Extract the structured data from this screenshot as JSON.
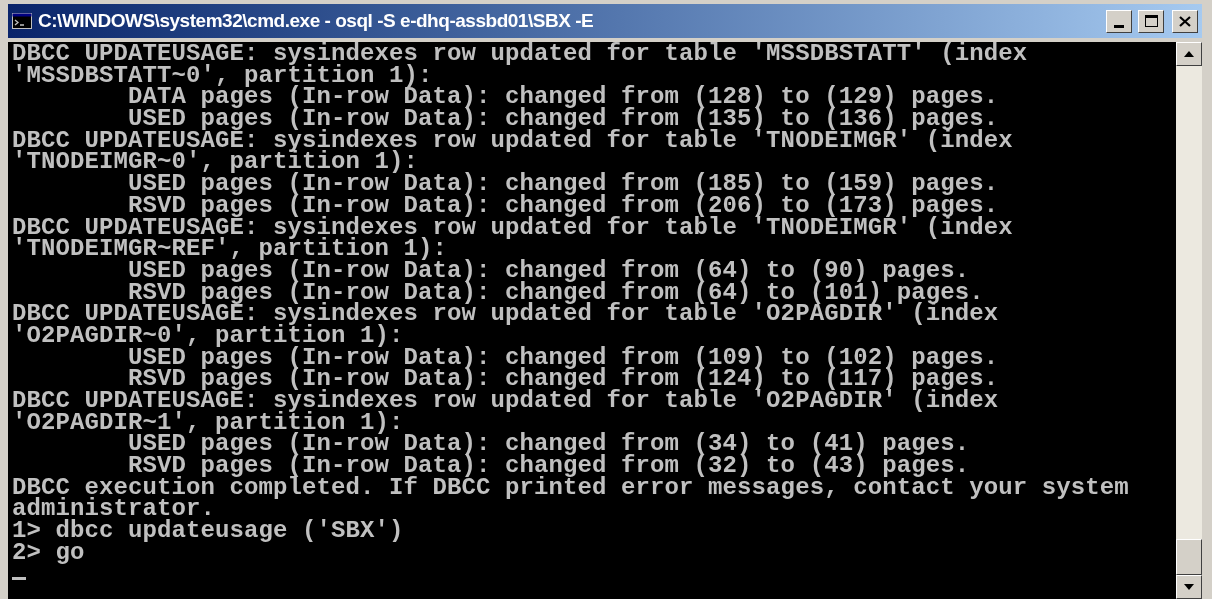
{
  "window": {
    "title": "C:\\WINDOWS\\system32\\cmd.exe - osql -S e-dhq-assbd01\\SBX -E"
  },
  "console": {
    "lines": [
      "DBCC UPDATEUSAGE: sysindexes row updated for table 'MSSDBSTATT' (index",
      "'MSSDBSTATT~0', partition 1):",
      "        DATA pages (In-row Data): changed from (128) to (129) pages.",
      "        USED pages (In-row Data): changed from (135) to (136) pages.",
      "DBCC UPDATEUSAGE: sysindexes row updated for table 'TNODEIMGR' (index",
      "'TNODEIMGR~0', partition 1):",
      "        USED pages (In-row Data): changed from (185) to (159) pages.",
      "        RSVD pages (In-row Data): changed from (206) to (173) pages.",
      "DBCC UPDATEUSAGE: sysindexes row updated for table 'TNODEIMGR' (index",
      "'TNODEIMGR~REF', partition 1):",
      "        USED pages (In-row Data): changed from (64) to (90) pages.",
      "        RSVD pages (In-row Data): changed from (64) to (101) pages.",
      "DBCC UPDATEUSAGE: sysindexes row updated for table 'O2PAGDIR' (index",
      "'O2PAGDIR~0', partition 1):",
      "        USED pages (In-row Data): changed from (109) to (102) pages.",
      "        RSVD pages (In-row Data): changed from (124) to (117) pages.",
      "DBCC UPDATEUSAGE: sysindexes row updated for table 'O2PAGDIR' (index",
      "'O2PAGDIR~1', partition 1):",
      "        USED pages (In-row Data): changed from (34) to (41) pages.",
      "        RSVD pages (In-row Data): changed from (32) to (43) pages.",
      "DBCC execution completed. If DBCC printed error messages, contact your system",
      "administrator.",
      "1> dbcc updateusage ('SBX')",
      "2> go"
    ]
  }
}
